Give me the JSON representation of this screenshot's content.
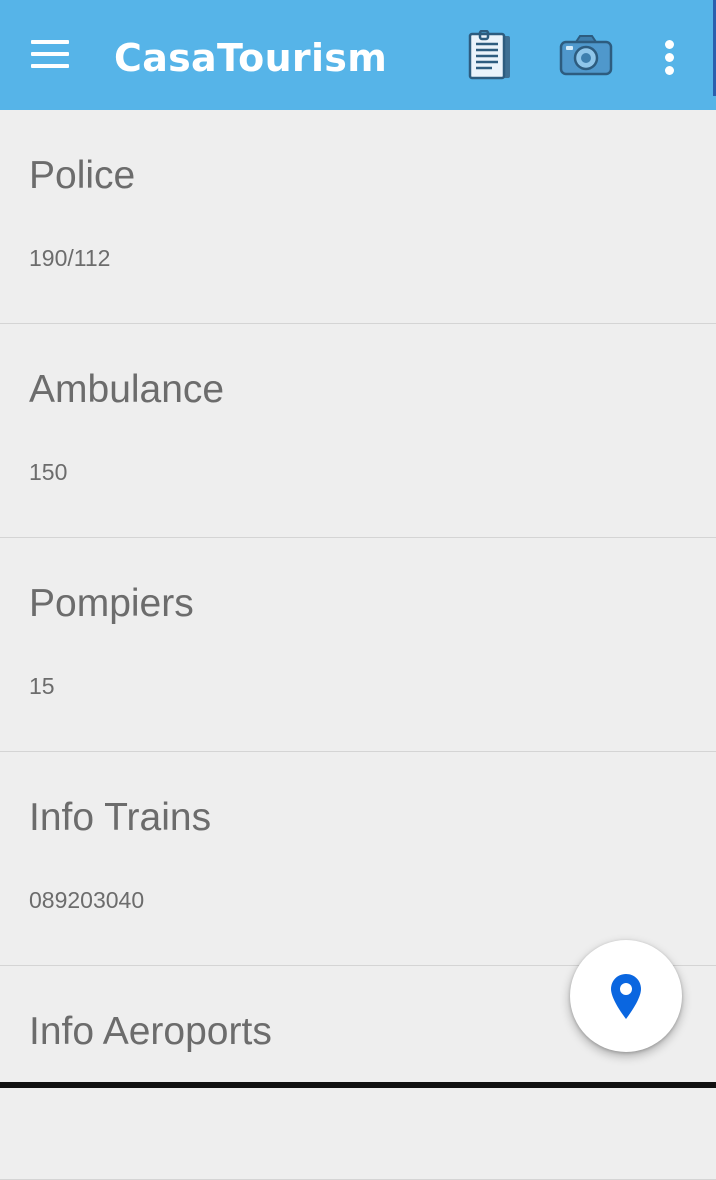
{
  "app": {
    "title": "CasaTourism",
    "theme_color": "#56b4e8",
    "text_color": "#6c6c6c",
    "accent_color": "#0a66e0"
  },
  "toolbar": {
    "menu_icon": "hamburger-menu-icon",
    "actions": [
      {
        "icon": "document-icon"
      },
      {
        "icon": "camera-icon"
      },
      {
        "icon": "more-vert-icon"
      }
    ]
  },
  "contacts": [
    {
      "title": "Police",
      "value": "190/112"
    },
    {
      "title": "Ambulance",
      "value": "150"
    },
    {
      "title": "Pompiers",
      "value": "15"
    },
    {
      "title": "Info Trains",
      "value": "089203040"
    },
    {
      "title": "Info Aeroports",
      "value": ""
    }
  ],
  "fab": {
    "icon": "location-pin-icon"
  }
}
